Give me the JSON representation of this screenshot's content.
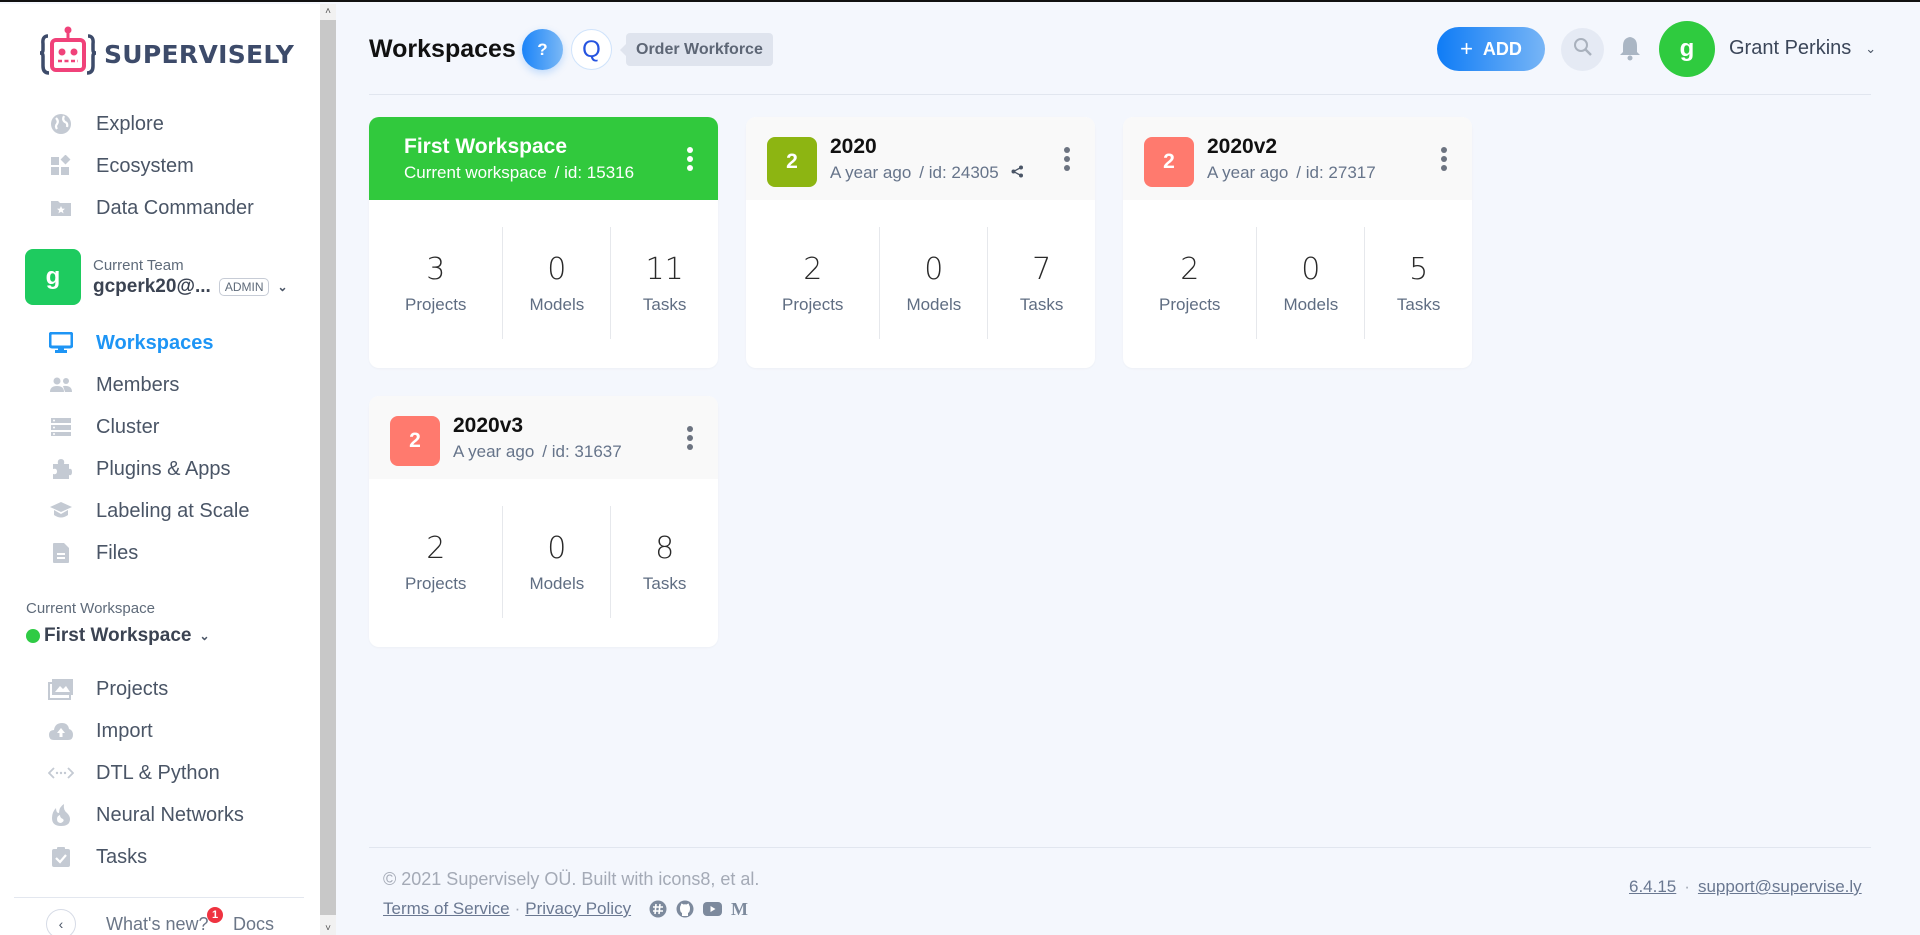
{
  "app": {
    "brand": "SUPERVISELY"
  },
  "sidebar": {
    "top_items": [
      {
        "label": "Explore",
        "icon": "globe-icon"
      },
      {
        "label": "Ecosystem",
        "icon": "ecosystem-icon"
      },
      {
        "label": "Data Commander",
        "icon": "folder-star-icon"
      }
    ],
    "team": {
      "avatar_letter": "g",
      "caption": "Current Team",
      "name": "gcperk20@...",
      "role_badge": "ADMIN"
    },
    "team_items": [
      {
        "label": "Workspaces",
        "icon": "monitor-icon",
        "active": true
      },
      {
        "label": "Members",
        "icon": "members-icon"
      },
      {
        "label": "Cluster",
        "icon": "cluster-icon"
      },
      {
        "label": "Plugins & Apps",
        "icon": "puzzle-icon"
      },
      {
        "label": "Labeling at Scale",
        "icon": "graduation-cap-icon"
      },
      {
        "label": "Files",
        "icon": "file-icon"
      }
    ],
    "workspace": {
      "caption": "Current Workspace",
      "name": "First Workspace",
      "status_color": "#2fcb45"
    },
    "workspace_items": [
      {
        "label": "Projects",
        "icon": "images-icon"
      },
      {
        "label": "Import",
        "icon": "cloud-upload-icon"
      },
      {
        "label": "DTL & Python",
        "icon": "code-icon"
      },
      {
        "label": "Neural Networks",
        "icon": "flame-icon"
      },
      {
        "label": "Tasks",
        "icon": "clipboard-check-icon"
      }
    ],
    "footer": {
      "whats_new": "What's new?",
      "whats_new_count": "1",
      "docs": "Docs"
    }
  },
  "header": {
    "title": "Workspaces",
    "help_label": "?",
    "q_label": "Q",
    "tooltip": "Order Workforce",
    "add_label": "ADD",
    "user": {
      "avatar_letter": "g",
      "name": "Grant Perkins"
    }
  },
  "workspaces": [
    {
      "badge": "",
      "badge_color": "",
      "title": "First Workspace",
      "subtitle": "Current workspace",
      "id_text": "/ id: 15316",
      "current": true,
      "shared": false,
      "stats": [
        {
          "value": "3",
          "label": "Projects"
        },
        {
          "value": "0",
          "label": "Models"
        },
        {
          "value": "11",
          "label": "Tasks"
        }
      ]
    },
    {
      "badge": "2",
      "badge_color": "#8db512",
      "title": "2020",
      "subtitle": "A year ago",
      "id_text": "/ id: 24305",
      "current": false,
      "shared": true,
      "stats": [
        {
          "value": "2",
          "label": "Projects"
        },
        {
          "value": "0",
          "label": "Models"
        },
        {
          "value": "7",
          "label": "Tasks"
        }
      ]
    },
    {
      "badge": "2",
      "badge_color": "#ff7a6e",
      "title": "2020v2",
      "subtitle": "A year ago",
      "id_text": "/ id: 27317",
      "current": false,
      "shared": false,
      "stats": [
        {
          "value": "2",
          "label": "Projects"
        },
        {
          "value": "0",
          "label": "Models"
        },
        {
          "value": "5",
          "label": "Tasks"
        }
      ]
    },
    {
      "badge": "2",
      "badge_color": "#ff7a6e",
      "title": "2020v3",
      "subtitle": "A year ago",
      "id_text": "/ id: 31637",
      "current": false,
      "shared": false,
      "stats": [
        {
          "value": "2",
          "label": "Projects"
        },
        {
          "value": "0",
          "label": "Models"
        },
        {
          "value": "8",
          "label": "Tasks"
        }
      ]
    }
  ],
  "footer": {
    "copyright": "© 2021 Supervisely OÜ. Built with icons8, et al.",
    "terms": "Terms of Service",
    "privacy": "Privacy Policy",
    "separator": "·",
    "version": "6.4.15",
    "support_email": "support@supervise.ly",
    "social": [
      "slack-icon",
      "github-icon",
      "youtube-icon",
      "medium-icon"
    ]
  }
}
